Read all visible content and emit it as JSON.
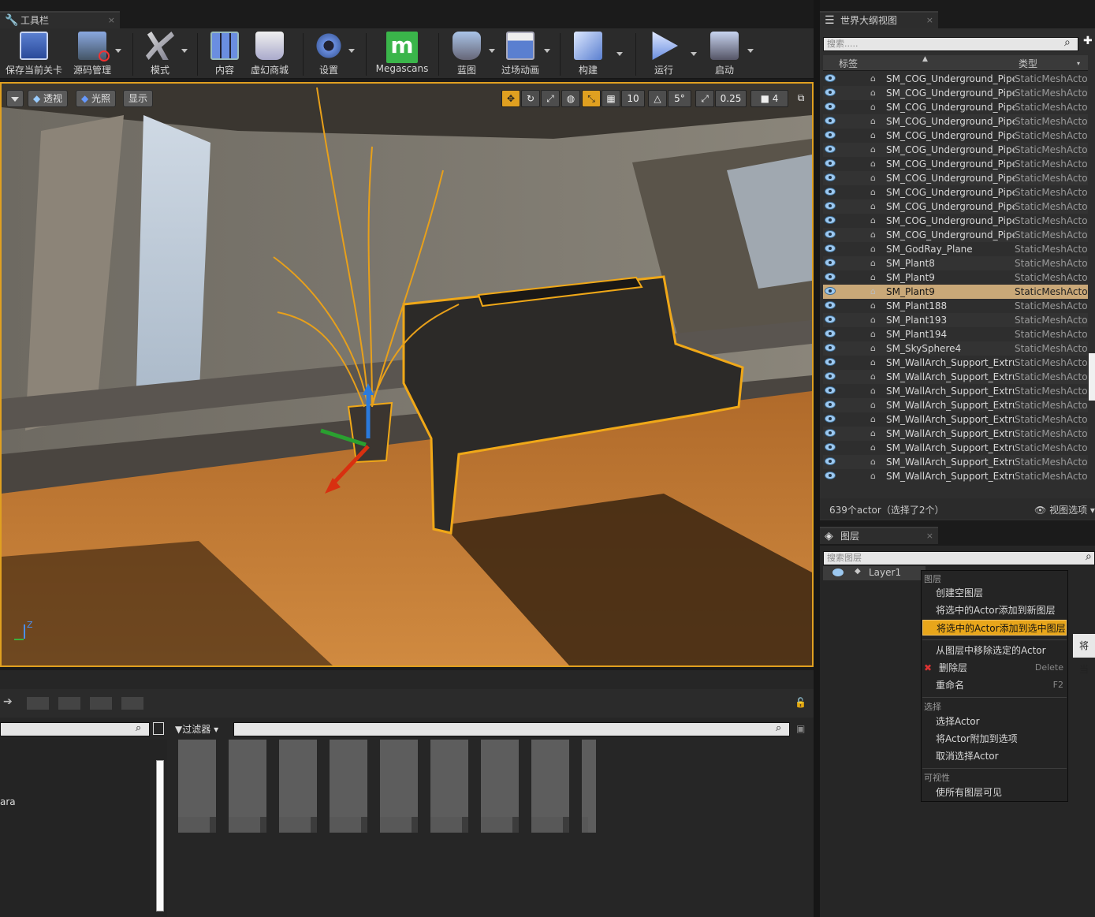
{
  "toolbar_tab": {
    "title": "工具栏",
    "close": "×"
  },
  "toolbar": {
    "buttons": [
      {
        "label": "保存当前关卡"
      },
      {
        "label": "源码管理"
      },
      {
        "label": "模式"
      },
      {
        "label": "内容"
      },
      {
        "label": "虚幻商城"
      },
      {
        "label": "设置"
      },
      {
        "label": "Megascans"
      },
      {
        "label": "蓝图"
      },
      {
        "label": "过场动画"
      },
      {
        "label": "构建"
      },
      {
        "label": "运行"
      },
      {
        "label": "启动"
      }
    ],
    "megascans_logo": "m"
  },
  "viewport": {
    "perspective": "透视",
    "lit": "光照",
    "show": "显示",
    "grid_snap": "10",
    "rot_snap": "5°",
    "scale_snap": "0.25",
    "cam_speed": "4",
    "axis_z": "Z"
  },
  "outliner": {
    "tab_title": "世界大纲视图",
    "close": "×",
    "search_placeholder": "搜索.....",
    "col_label": "标签",
    "col_type": "类型",
    "rows": [
      {
        "name": "SM_COG_Underground_Pipe_V",
        "type": "StaticMeshActor",
        "selected": false
      },
      {
        "name": "SM_COG_Underground_Pipe_V",
        "type": "StaticMeshActor",
        "selected": false
      },
      {
        "name": "SM_COG_Underground_Pipe_V",
        "type": "StaticMeshActor",
        "selected": false
      },
      {
        "name": "SM_COG_Underground_Pipe_V",
        "type": "StaticMeshActor",
        "selected": false
      },
      {
        "name": "SM_COG_Underground_Pipe_V",
        "type": "StaticMeshActor",
        "selected": false
      },
      {
        "name": "SM_COG_Underground_Pipe_V",
        "type": "StaticMeshActor",
        "selected": false
      },
      {
        "name": "SM_COG_Underground_Pipe_V",
        "type": "StaticMeshActor",
        "selected": false
      },
      {
        "name": "SM_COG_Underground_Pipe_V",
        "type": "StaticMeshActor",
        "selected": false
      },
      {
        "name": "SM_COG_Underground_Pipe_V",
        "type": "StaticMeshActor",
        "selected": false
      },
      {
        "name": "SM_COG_Underground_Pipe_V",
        "type": "StaticMeshActor",
        "selected": false
      },
      {
        "name": "SM_COG_Underground_Pipe_V",
        "type": "StaticMeshActor",
        "selected": false
      },
      {
        "name": "SM_COG_Underground_Pipe_V",
        "type": "StaticMeshActor",
        "selected": false
      },
      {
        "name": "SM_GodRay_Plane",
        "type": "StaticMeshActor",
        "selected": false
      },
      {
        "name": "SM_Plant8",
        "type": "StaticMeshActor",
        "selected": false
      },
      {
        "name": "SM_Plant9",
        "type": "StaticMeshActor",
        "selected": false
      },
      {
        "name": "SM_Plant9",
        "type": "StaticMeshActor",
        "selected": true
      },
      {
        "name": "SM_Plant188",
        "type": "StaticMeshActor",
        "selected": false
      },
      {
        "name": "SM_Plant193",
        "type": "StaticMeshActor",
        "selected": false
      },
      {
        "name": "SM_Plant194",
        "type": "StaticMeshActor",
        "selected": false
      },
      {
        "name": "SM_SkySphere4",
        "type": "StaticMeshActor",
        "selected": false
      },
      {
        "name": "SM_WallArch_Support_Extrude",
        "type": "StaticMeshActor",
        "selected": false
      },
      {
        "name": "SM_WallArch_Support_Extrude",
        "type": "StaticMeshActor",
        "selected": false
      },
      {
        "name": "SM_WallArch_Support_Extrude",
        "type": "StaticMeshActor",
        "selected": false
      },
      {
        "name": "SM_WallArch_Support_Extrude",
        "type": "StaticMeshActor",
        "selected": false
      },
      {
        "name": "SM_WallArch_Support_Extrude",
        "type": "StaticMeshActor",
        "selected": false
      },
      {
        "name": "SM_WallArch_Support_Extrude",
        "type": "StaticMeshActor",
        "selected": false
      },
      {
        "name": "SM_WallArch_Support_Extrude",
        "type": "StaticMeshActor",
        "selected": false
      },
      {
        "name": "SM_WallArch_Support_Extrude",
        "type": "StaticMeshActor",
        "selected": false
      },
      {
        "name": "SM_WallArch_Support_Extrude",
        "type": "StaticMeshActor",
        "selected": false
      }
    ],
    "status": "639个actor（选择了2个）",
    "view_options": "视图选项"
  },
  "layers": {
    "tab_title": "图层",
    "close": "×",
    "search_placeholder": "搜索图层",
    "layer_name": "Layer1"
  },
  "context_menu": {
    "section_layers": "图层",
    "create_empty": "创建空图层",
    "add_to_new": "将选中的Actor添加到新图层",
    "add_to_selected": "将选中的Actor添加到选中图层",
    "remove_from_layer": "从图层中移除选定的Actor",
    "delete_layer": "删除层",
    "delete_shortcut": "Delete",
    "rename": "重命名",
    "rename_shortcut": "F2",
    "section_select": "选择",
    "select_actor": "选择Actor",
    "append_actor": "将Actor附加到选项",
    "deselect_actor": "取消选择Actor",
    "section_visibility": "可视性",
    "make_all_visible": "使所有图层可见"
  },
  "tooltip_fragment": "将当",
  "content_browser": {
    "filter_label": "过滤器",
    "left_fragment": "ara"
  },
  "colors": {
    "accent": "#e0a020",
    "selection_row": "#c9a878",
    "menu_highlight": "#e8a61b"
  }
}
